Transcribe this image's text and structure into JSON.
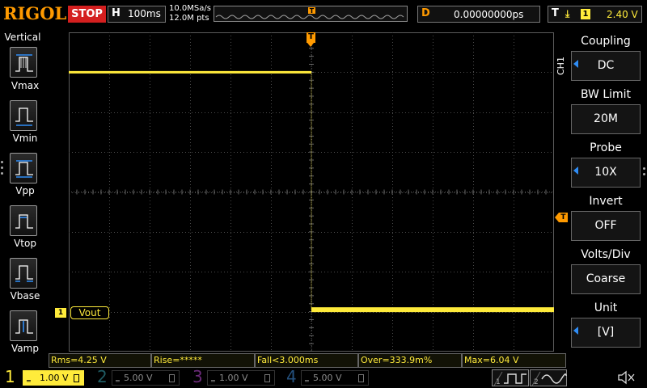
{
  "topbar": {
    "brand": "RIGOL",
    "run_state": "STOP",
    "timebase_key": "H",
    "timebase_value": "100ms",
    "sample_rate": "10.0MSa/s",
    "memory_depth": "12.0M pts",
    "delay_key": "D",
    "delay_value": "0.00000000ps",
    "trigger_key": "T",
    "trigger_edge": "⤓",
    "trigger_source": "1",
    "trigger_level": "2.40 V"
  },
  "left_menu": {
    "title": "Vertical",
    "items": [
      {
        "label": "Vmax"
      },
      {
        "label": "Vmin"
      },
      {
        "label": "Vpp"
      },
      {
        "label": "Vtop"
      },
      {
        "label": "Vbase"
      },
      {
        "label": "Vamp"
      }
    ]
  },
  "right_menu": {
    "channel_label": "CH1",
    "items": [
      {
        "title": "Coupling",
        "value": "DC",
        "has_arrow": true
      },
      {
        "title": "BW Limit",
        "value": "20M",
        "has_arrow": false
      },
      {
        "title": "Probe",
        "value": "10X",
        "has_arrow": true
      },
      {
        "title": "Invert",
        "value": "OFF",
        "has_arrow": false
      },
      {
        "title": "Volts/Div",
        "value": "Coarse",
        "has_arrow": false
      },
      {
        "title": "Unit",
        "value": "[V]",
        "has_arrow": true
      }
    ]
  },
  "channel_marker": {
    "number": "1",
    "label": "Vout"
  },
  "trigger_marker": "T",
  "measurements": [
    "Rms=4.25 V",
    "Rise=*****",
    "Fall<3.000ms",
    "Over=333.9m%",
    "Max=6.04 V"
  ],
  "channels": [
    {
      "number": "1",
      "scale": "1.00 V",
      "active": true
    },
    {
      "number": "2",
      "scale": "5.00 V",
      "active": false
    },
    {
      "number": "3",
      "scale": "1.00 V",
      "active": false
    },
    {
      "number": "4",
      "scale": "5.00 V",
      "active": false
    }
  ],
  "colors": {
    "ch1": "#ffeb3b",
    "ch2": "#26c6da",
    "ch3": "#e040fb",
    "ch4": "#2f8df6",
    "trigger": "#ff9a00",
    "stop": "#d41f1f"
  },
  "chart_data": {
    "type": "line",
    "grid": {
      "divisions_x": 12,
      "divisions_y": 8
    },
    "series": [
      {
        "name": "Vout",
        "x_div": [
          0,
          6,
          6,
          12
        ],
        "y_div": [
          3.0,
          3.0,
          -2.95,
          -2.95
        ]
      }
    ]
  }
}
